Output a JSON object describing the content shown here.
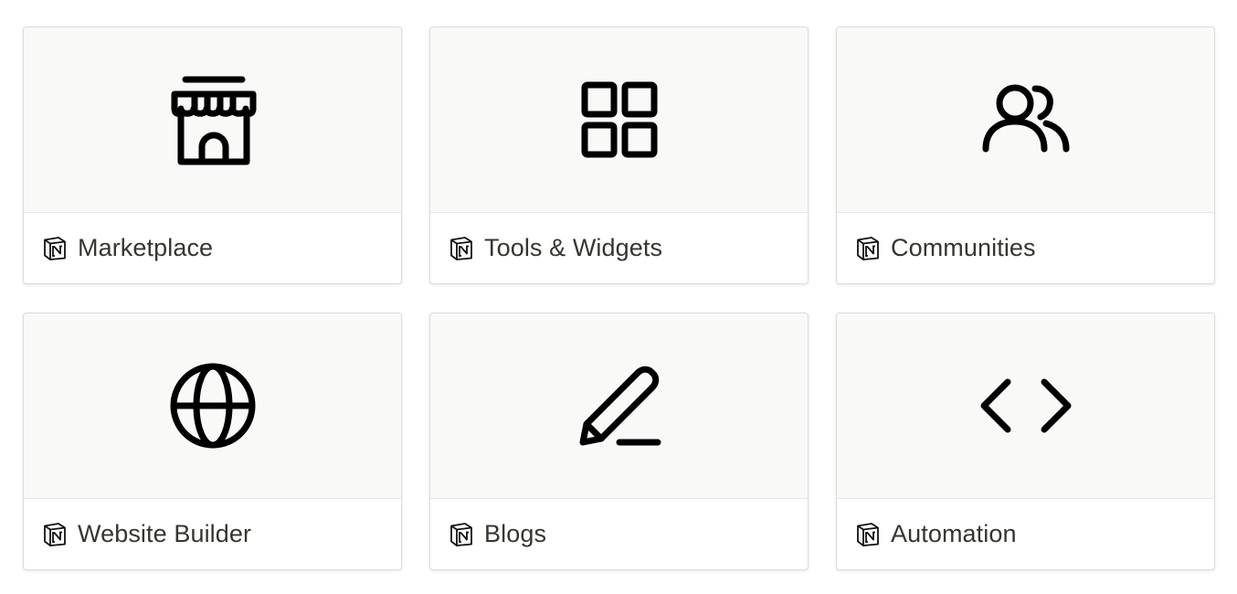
{
  "cards": [
    {
      "title": "Marketplace",
      "icon": "storefront-icon",
      "page_icon": "notion-logo-icon"
    },
    {
      "title": "Tools & Widgets",
      "icon": "grid-squares-icon",
      "page_icon": "notion-logo-icon"
    },
    {
      "title": "Communities",
      "icon": "users-group-icon",
      "page_icon": "notion-logo-icon"
    },
    {
      "title": "Website Builder",
      "icon": "globe-icon",
      "page_icon": "notion-logo-icon"
    },
    {
      "title": "Blogs",
      "icon": "pencil-icon",
      "page_icon": "notion-logo-icon"
    },
    {
      "title": "Automation",
      "icon": "code-brackets-icon",
      "page_icon": "notion-logo-icon"
    }
  ],
  "colors": {
    "cover_background": "#f9f9f8",
    "text": "#37352f",
    "border": "#dcdcda",
    "icon": "#000000"
  }
}
